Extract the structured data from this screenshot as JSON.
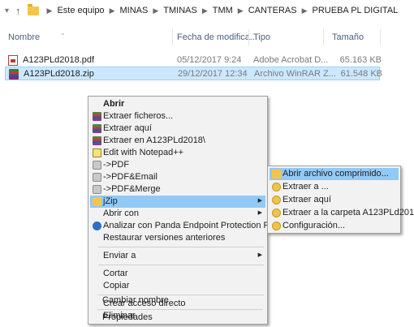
{
  "address": {
    "path": [
      "Este equipo",
      "MINAS",
      "TMINAS",
      "TMM",
      "CANTERAS",
      "PRUEBA PL DIGITAL"
    ]
  },
  "columns": {
    "name": "Nombre",
    "date": "Fecha de modifica...",
    "type": "Tipo",
    "size": "Tamaño"
  },
  "files": [
    {
      "name": "A123PLd2018.pdf",
      "date": "05/12/2017 9:24",
      "type": "Adobe Acrobat D...",
      "size": "65.163 KB",
      "icon": "pdf-file-icon"
    },
    {
      "name": "A123PLd2018.zip",
      "date": "29/12/2017 12:34",
      "type": "Archivo WinRAR Z...",
      "size": "61.548 KB",
      "icon": "winrar-archive-icon"
    }
  ],
  "context_menu": {
    "open": "Abrir",
    "extract_files": "Extraer ficheros...",
    "extract_here": "Extraer aquí",
    "extract_to": "Extraer en A123PLd2018\\",
    "edit_notepad": "Edit with Notepad++",
    "to_pdf": "->PDF",
    "to_pdf_email": "->PDF&Email",
    "to_pdf_merge": "->PDF&Merge",
    "jzip": "jZip",
    "open_with": "Abrir con",
    "panda": "Analizar con Panda Endpoint Protection Plus",
    "restore": "Restaurar versiones anteriores",
    "send_to": "Enviar a",
    "cut": "Cortar",
    "copy": "Copiar",
    "create_shortcut": "Crear acceso directo",
    "delete": "Eliminar",
    "rename": "Cambiar nombre",
    "properties": "Propiedades"
  },
  "jzip_submenu": {
    "open_archive": "Abrir archivo comprimido...",
    "extract_to": "Extraer a ...",
    "extract_here": "Extraer aquí",
    "extract_to_folder": "Extraer a la carpeta A123PLd2018",
    "configuration": "Configuración..."
  },
  "colors": {
    "selection": "#cce8ff",
    "menu_highlight": "#91c9f7",
    "header_text": "#4d6082"
  }
}
